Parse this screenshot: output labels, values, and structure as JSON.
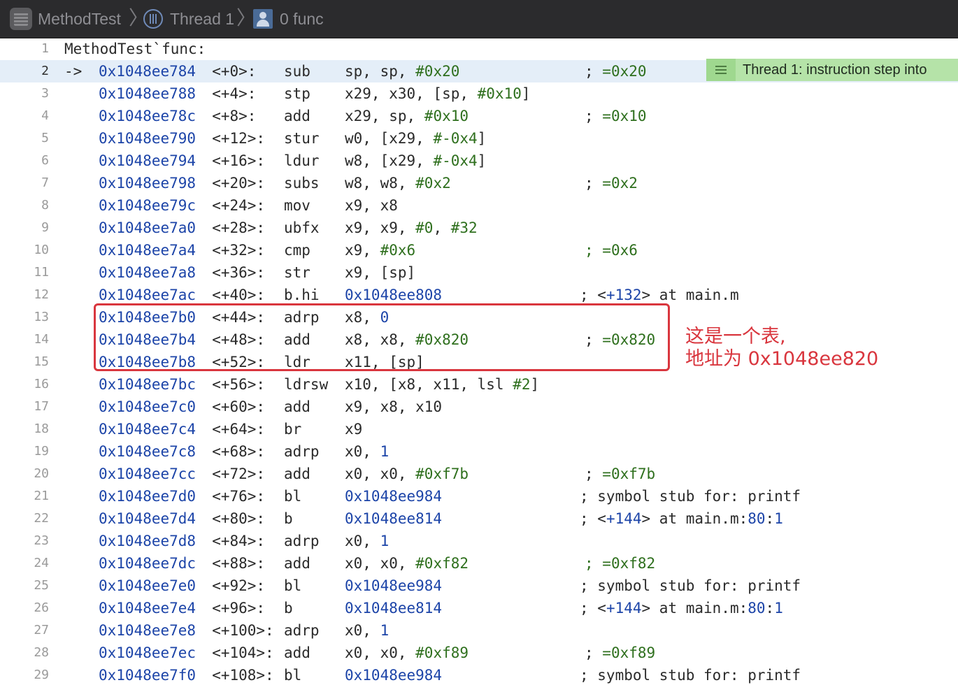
{
  "breadcrumb": {
    "project": "MethodTest",
    "thread": "Thread 1",
    "frame": "0 func"
  },
  "header_line": {
    "number": "1",
    "text": "MethodTest`func:"
  },
  "current_line_marker": "->",
  "thread_badge": {
    "label": "Thread 1: instruction step into",
    "icon": "list-icon"
  },
  "annotation": {
    "line1": "这是一个表,",
    "line2": "地址为 0x1048ee820"
  },
  "colors": {
    "address": "#1c44a8",
    "literal": "#2e6f1d",
    "current_line_bg": "#e4eef8",
    "badge_bg": "#b5e3a8",
    "annotation_red": "#d9363e",
    "jumpbar_bg": "#2b2b2d"
  },
  "rows": [
    {
      "ln": "2",
      "addr": "0x1048ee784",
      "off": "<+0>:",
      "mn": "sub",
      "ops": [
        {
          "t": "sp, sp, ",
          "k": "plain"
        },
        {
          "t": "#0x20",
          "k": "num"
        }
      ],
      "cmt": [
        {
          "t": "; ",
          "k": "plain"
        },
        {
          "t": "=0x20",
          "k": "num"
        }
      ]
    },
    {
      "ln": "3",
      "addr": "0x1048ee788",
      "off": "<+4>:",
      "mn": "stp",
      "ops": [
        {
          "t": "x29, x30, [sp, ",
          "k": "plain"
        },
        {
          "t": "#0x10",
          "k": "num"
        },
        {
          "t": "]",
          "k": "plain"
        }
      ],
      "cmt": []
    },
    {
      "ln": "4",
      "addr": "0x1048ee78c",
      "off": "<+8>:",
      "mn": "add",
      "ops": [
        {
          "t": "x29, sp, ",
          "k": "plain"
        },
        {
          "t": "#0x10",
          "k": "num"
        }
      ],
      "cmt": [
        {
          "t": "; ",
          "k": "plain"
        },
        {
          "t": "=0x10",
          "k": "num"
        }
      ]
    },
    {
      "ln": "5",
      "addr": "0x1048ee790",
      "off": "<+12>:",
      "mn": "stur",
      "ops": [
        {
          "t": "w0, [x29, ",
          "k": "plain"
        },
        {
          "t": "#-0x4",
          "k": "num"
        },
        {
          "t": "]",
          "k": "plain"
        }
      ],
      "cmt": []
    },
    {
      "ln": "6",
      "addr": "0x1048ee794",
      "off": "<+16>:",
      "mn": "ldur",
      "ops": [
        {
          "t": "w8, [x29, ",
          "k": "plain"
        },
        {
          "t": "#-0x4",
          "k": "num"
        },
        {
          "t": "]",
          "k": "plain"
        }
      ],
      "cmt": []
    },
    {
      "ln": "7",
      "addr": "0x1048ee798",
      "off": "<+20>:",
      "mn": "subs",
      "ops": [
        {
          "t": "w8, w8, ",
          "k": "plain"
        },
        {
          "t": "#0x2",
          "k": "num"
        }
      ],
      "cmt": [
        {
          "t": "; ",
          "k": "plain"
        },
        {
          "t": "=0x2",
          "k": "num"
        }
      ]
    },
    {
      "ln": "8",
      "addr": "0x1048ee79c",
      "off": "<+24>:",
      "mn": "mov",
      "ops": [
        {
          "t": "x9, x8",
          "k": "plain"
        }
      ],
      "cmt": []
    },
    {
      "ln": "9",
      "addr": "0x1048ee7a0",
      "off": "<+28>:",
      "mn": "ubfx",
      "ops": [
        {
          "t": "x9, x9, ",
          "k": "plain"
        },
        {
          "t": "#0",
          "k": "num"
        },
        {
          "t": ", ",
          "k": "plain"
        },
        {
          "t": "#32",
          "k": "num"
        }
      ],
      "cmt": []
    },
    {
      "ln": "10",
      "addr": "0x1048ee7a4",
      "off": "<+32>:",
      "mn": "cmp",
      "ops": [
        {
          "t": "x9, ",
          "k": "plain"
        },
        {
          "t": "#0x6",
          "k": "num"
        }
      ],
      "cmt": [
        {
          "t": "; ",
          "k": "num"
        },
        {
          "t": "=0x6",
          "k": "num"
        }
      ]
    },
    {
      "ln": "11",
      "addr": "0x1048ee7a8",
      "off": "<+36>:",
      "mn": "str",
      "ops": [
        {
          "t": "x9, [sp]",
          "k": "plain"
        }
      ],
      "cmt": []
    },
    {
      "ln": "12",
      "addr": "0x1048ee7ac",
      "off": "<+40>:",
      "mn": "b.hi",
      "ops": [
        {
          "t": "0x1048ee808",
          "k": "addr"
        }
      ],
      "cmt": [
        {
          "t": "; <",
          "k": "plain"
        },
        {
          "t": "+132",
          "k": "addr"
        },
        {
          "t": "> at main.m",
          "k": "plain"
        }
      ]
    },
    {
      "ln": "13",
      "addr": "0x1048ee7b0",
      "off": "<+44>:",
      "mn": "adrp",
      "ops": [
        {
          "t": "x8, ",
          "k": "plain"
        },
        {
          "t": "0",
          "k": "addr"
        }
      ],
      "cmt": []
    },
    {
      "ln": "14",
      "addr": "0x1048ee7b4",
      "off": "<+48>:",
      "mn": "add",
      "ops": [
        {
          "t": "x8, x8, ",
          "k": "plain"
        },
        {
          "t": "#0x820",
          "k": "num"
        }
      ],
      "cmt": [
        {
          "t": "; ",
          "k": "plain"
        },
        {
          "t": "=0x820",
          "k": "num"
        }
      ]
    },
    {
      "ln": "15",
      "addr": "0x1048ee7b8",
      "off": "<+52>:",
      "mn": "ldr",
      "ops": [
        {
          "t": "x11, [sp]",
          "k": "plain"
        }
      ],
      "cmt": []
    },
    {
      "ln": "16",
      "addr": "0x1048ee7bc",
      "off": "<+56>:",
      "mn": "ldrsw",
      "ops": [
        {
          "t": "x10, [x8, x11, lsl ",
          "k": "plain"
        },
        {
          "t": "#2",
          "k": "num"
        },
        {
          "t": "]",
          "k": "plain"
        }
      ],
      "cmt": []
    },
    {
      "ln": "17",
      "addr": "0x1048ee7c0",
      "off": "<+60>:",
      "mn": "add",
      "ops": [
        {
          "t": "x9, x8, x10",
          "k": "plain"
        }
      ],
      "cmt": []
    },
    {
      "ln": "18",
      "addr": "0x1048ee7c4",
      "off": "<+64>:",
      "mn": "br",
      "ops": [
        {
          "t": "x9",
          "k": "plain"
        }
      ],
      "cmt": []
    },
    {
      "ln": "19",
      "addr": "0x1048ee7c8",
      "off": "<+68>:",
      "mn": "adrp",
      "ops": [
        {
          "t": "x0, ",
          "k": "plain"
        },
        {
          "t": "1",
          "k": "addr"
        }
      ],
      "cmt": []
    },
    {
      "ln": "20",
      "addr": "0x1048ee7cc",
      "off": "<+72>:",
      "mn": "add",
      "ops": [
        {
          "t": "x0, x0, ",
          "k": "plain"
        },
        {
          "t": "#0xf7b",
          "k": "num"
        }
      ],
      "cmt": [
        {
          "t": "; ",
          "k": "plain"
        },
        {
          "t": "=0xf7b",
          "k": "num"
        }
      ]
    },
    {
      "ln": "21",
      "addr": "0x1048ee7d0",
      "off": "<+76>:",
      "mn": "bl",
      "ops": [
        {
          "t": "0x1048ee984",
          "k": "addr"
        }
      ],
      "cmt": [
        {
          "t": "; symbol stub for: printf",
          "k": "plain"
        }
      ]
    },
    {
      "ln": "22",
      "addr": "0x1048ee7d4",
      "off": "<+80>:",
      "mn": "b",
      "ops": [
        {
          "t": "0x1048ee814",
          "k": "addr"
        }
      ],
      "cmt": [
        {
          "t": "; <",
          "k": "plain"
        },
        {
          "t": "+144",
          "k": "addr"
        },
        {
          "t": "> at main.m:",
          "k": "plain"
        },
        {
          "t": "80",
          "k": "addr"
        },
        {
          "t": ":",
          "k": "plain"
        },
        {
          "t": "1",
          "k": "addr"
        }
      ]
    },
    {
      "ln": "23",
      "addr": "0x1048ee7d8",
      "off": "<+84>:",
      "mn": "adrp",
      "ops": [
        {
          "t": "x0, ",
          "k": "plain"
        },
        {
          "t": "1",
          "k": "addr"
        }
      ],
      "cmt": []
    },
    {
      "ln": "24",
      "addr": "0x1048ee7dc",
      "off": "<+88>:",
      "mn": "add",
      "ops": [
        {
          "t": "x0, x0, ",
          "k": "plain"
        },
        {
          "t": "#0xf82",
          "k": "num"
        }
      ],
      "cmt": [
        {
          "t": "; ",
          "k": "num"
        },
        {
          "t": "=0xf82",
          "k": "num"
        }
      ]
    },
    {
      "ln": "25",
      "addr": "0x1048ee7e0",
      "off": "<+92>:",
      "mn": "bl",
      "ops": [
        {
          "t": "0x1048ee984",
          "k": "addr"
        }
      ],
      "cmt": [
        {
          "t": "; symbol stub for: printf",
          "k": "plain"
        }
      ]
    },
    {
      "ln": "26",
      "addr": "0x1048ee7e4",
      "off": "<+96>:",
      "mn": "b",
      "ops": [
        {
          "t": "0x1048ee814",
          "k": "addr"
        }
      ],
      "cmt": [
        {
          "t": "; <",
          "k": "plain"
        },
        {
          "t": "+144",
          "k": "addr"
        },
        {
          "t": "> at main.m:",
          "k": "plain"
        },
        {
          "t": "80",
          "k": "addr"
        },
        {
          "t": ":",
          "k": "plain"
        },
        {
          "t": "1",
          "k": "addr"
        }
      ]
    },
    {
      "ln": "27",
      "addr": "0x1048ee7e8",
      "off": "<+100>:",
      "mn": "adrp",
      "ops": [
        {
          "t": "x0, ",
          "k": "plain"
        },
        {
          "t": "1",
          "k": "addr"
        }
      ],
      "cmt": []
    },
    {
      "ln": "28",
      "addr": "0x1048ee7ec",
      "off": "<+104>:",
      "mn": "add",
      "ops": [
        {
          "t": "x0, x0, ",
          "k": "plain"
        },
        {
          "t": "#0xf89",
          "k": "num"
        }
      ],
      "cmt": [
        {
          "t": "; ",
          "k": "plain"
        },
        {
          "t": "=0xf89",
          "k": "num"
        }
      ]
    },
    {
      "ln": "29",
      "addr": "0x1048ee7f0",
      "off": "<+108>:",
      "mn": "bl",
      "ops": [
        {
          "t": "0x1048ee984",
          "k": "addr"
        }
      ],
      "cmt": [
        {
          "t": "; symbol stub for: printf",
          "k": "plain"
        }
      ]
    }
  ]
}
